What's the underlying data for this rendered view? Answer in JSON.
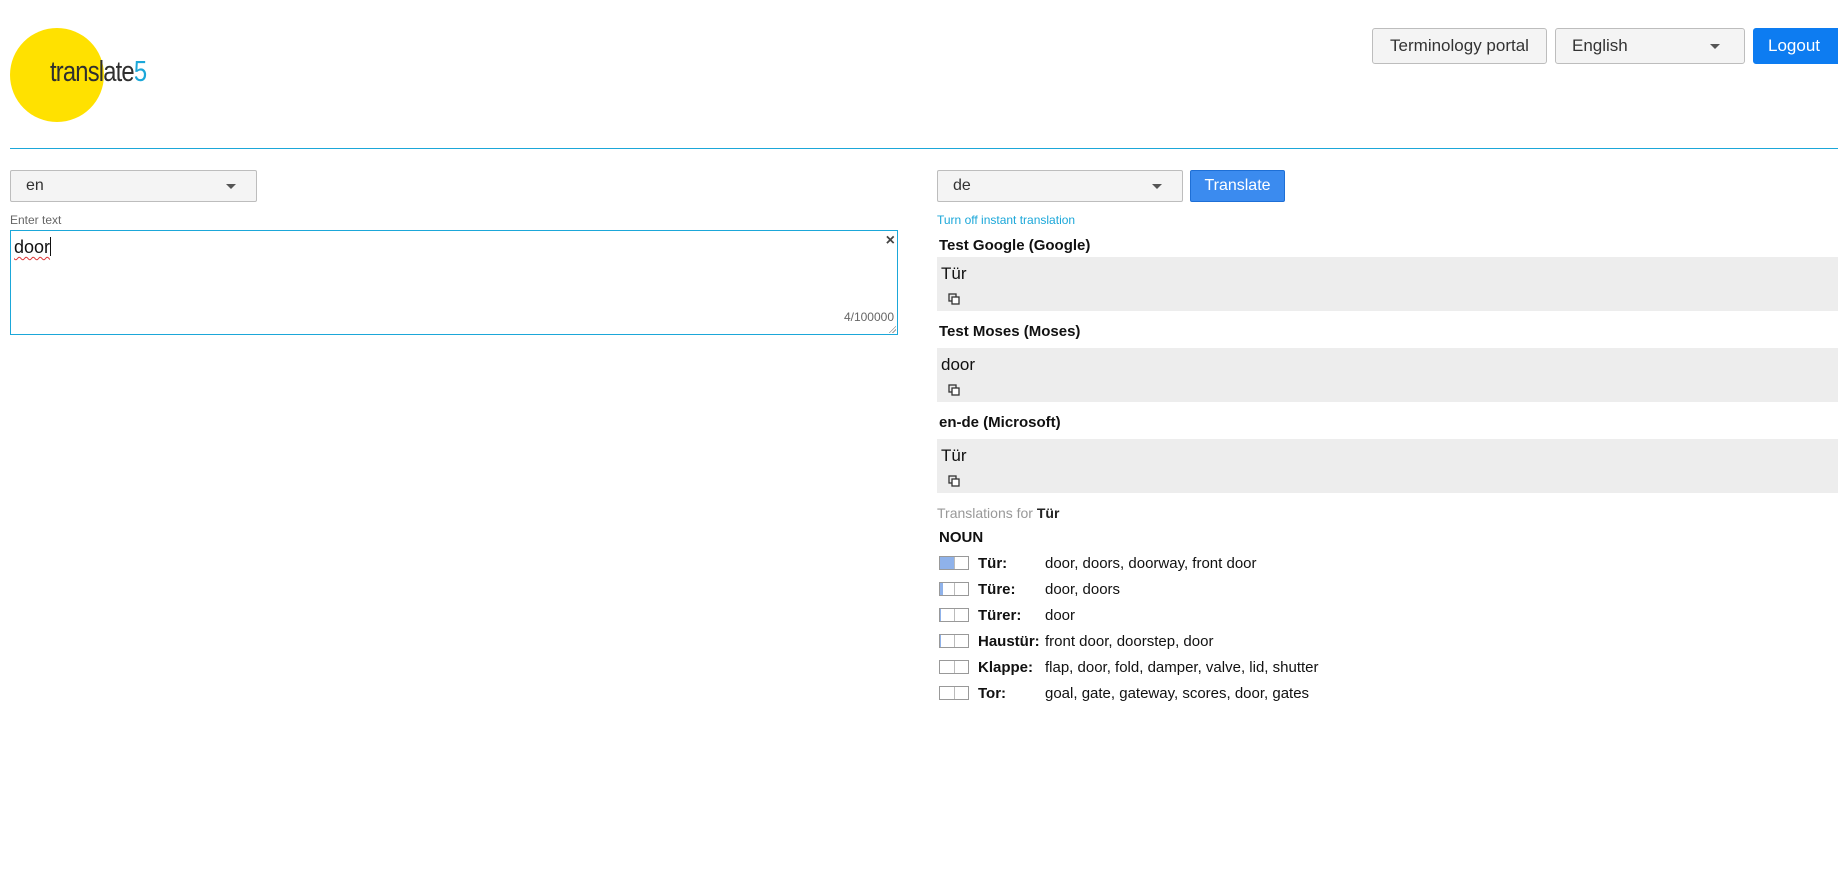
{
  "logo": {
    "name": "translate",
    "digit": "5"
  },
  "header": {
    "terminology_portal": "Terminology portal",
    "language": "English",
    "logout": "Logout"
  },
  "source": {
    "language": "en",
    "label": "Enter text",
    "text": "door",
    "char_count": "4/100000"
  },
  "target": {
    "language": "de",
    "translate_button": "Translate",
    "instant_toggle": "Turn off instant translation"
  },
  "results": [
    {
      "title": "Test Google (Google)",
      "text": "Tür"
    },
    {
      "title": "Test Moses (Moses)",
      "text": "door"
    },
    {
      "title": "en-de (Microsoft)",
      "text": "Tür"
    }
  ],
  "dictionary": {
    "heading_prefix": "Translations for",
    "heading_word": "Tür",
    "part_of_speech": "NOUN",
    "entries": [
      {
        "word": "Tür:",
        "translations": "door, doors, doorway, front door",
        "frequency": 0.5
      },
      {
        "word": "Türe:",
        "translations": "door, doors",
        "frequency": 0.1
      },
      {
        "word": "Türer:",
        "translations": "door",
        "frequency": 0.03
      },
      {
        "word": "Haustür:",
        "translations": "front door, doorstep, door",
        "frequency": 0.03
      },
      {
        "word": "Klappe:",
        "translations": "flap, door, fold, damper, valve, lid, shutter",
        "frequency": 0
      },
      {
        "word": "Tor:",
        "translations": "goal, gate, gateway, scores, door, gates",
        "frequency": 0
      }
    ]
  },
  "colors": {
    "accent": "#1ba7d9",
    "logo_yellow": "#ffe100",
    "logout_blue": "#0d7cf1",
    "translate_blue": "#3b8bef",
    "result_bg": "#ededed"
  }
}
